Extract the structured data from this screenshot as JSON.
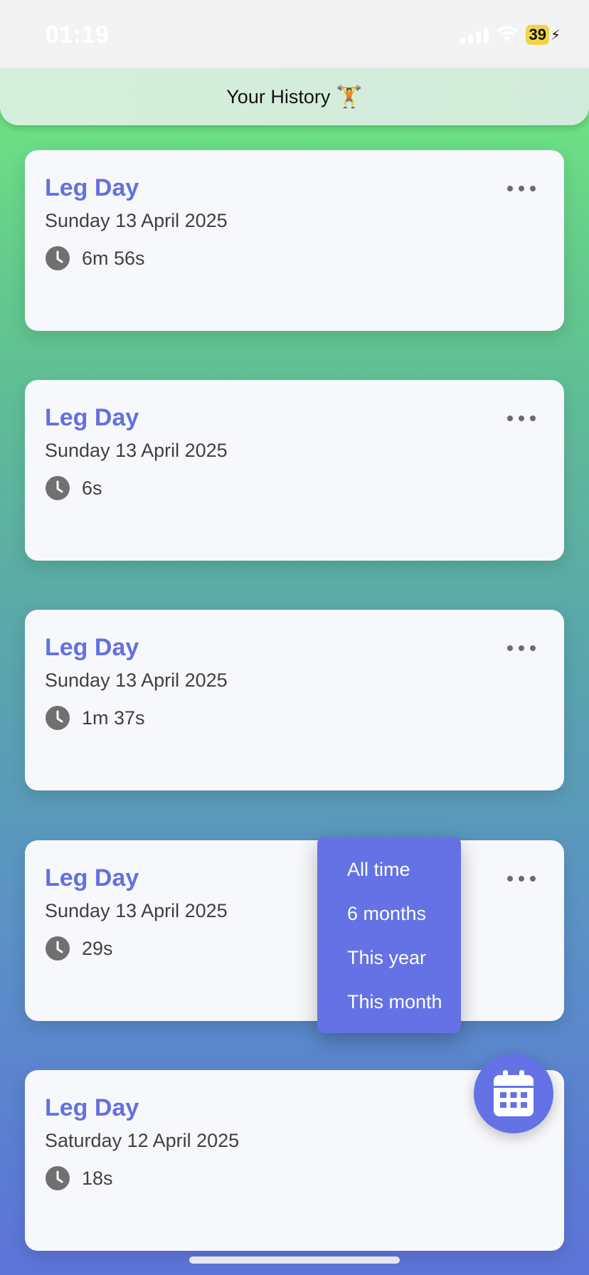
{
  "status_bar": {
    "time": "01:19",
    "battery": "39"
  },
  "header": {
    "title": "Your History",
    "emoji": "🏋️"
  },
  "workouts": [
    {
      "title": "Leg Day",
      "date": "Sunday 13 April 2025",
      "duration": "6m 56s"
    },
    {
      "title": "Leg Day",
      "date": "Sunday 13 April 2025",
      "duration": "6s"
    },
    {
      "title": "Leg Day",
      "date": "Sunday 13 April 2025",
      "duration": "1m 37s"
    },
    {
      "title": "Leg Day",
      "date": "Sunday 13 April 2025",
      "duration": "29s"
    },
    {
      "title": "Leg Day",
      "date": "Saturday 12 April 2025",
      "duration": "18s"
    }
  ],
  "filter_menu": {
    "options": [
      "All time",
      "6 months",
      "This year",
      "This month"
    ]
  },
  "icons": {
    "card_time": "clock-icon",
    "card_more": "more-options-icon",
    "fab": "calendar-icon"
  },
  "colors": {
    "accent": "#6472e6",
    "title": "#6370e0",
    "card_background": "#f7f8fb"
  }
}
